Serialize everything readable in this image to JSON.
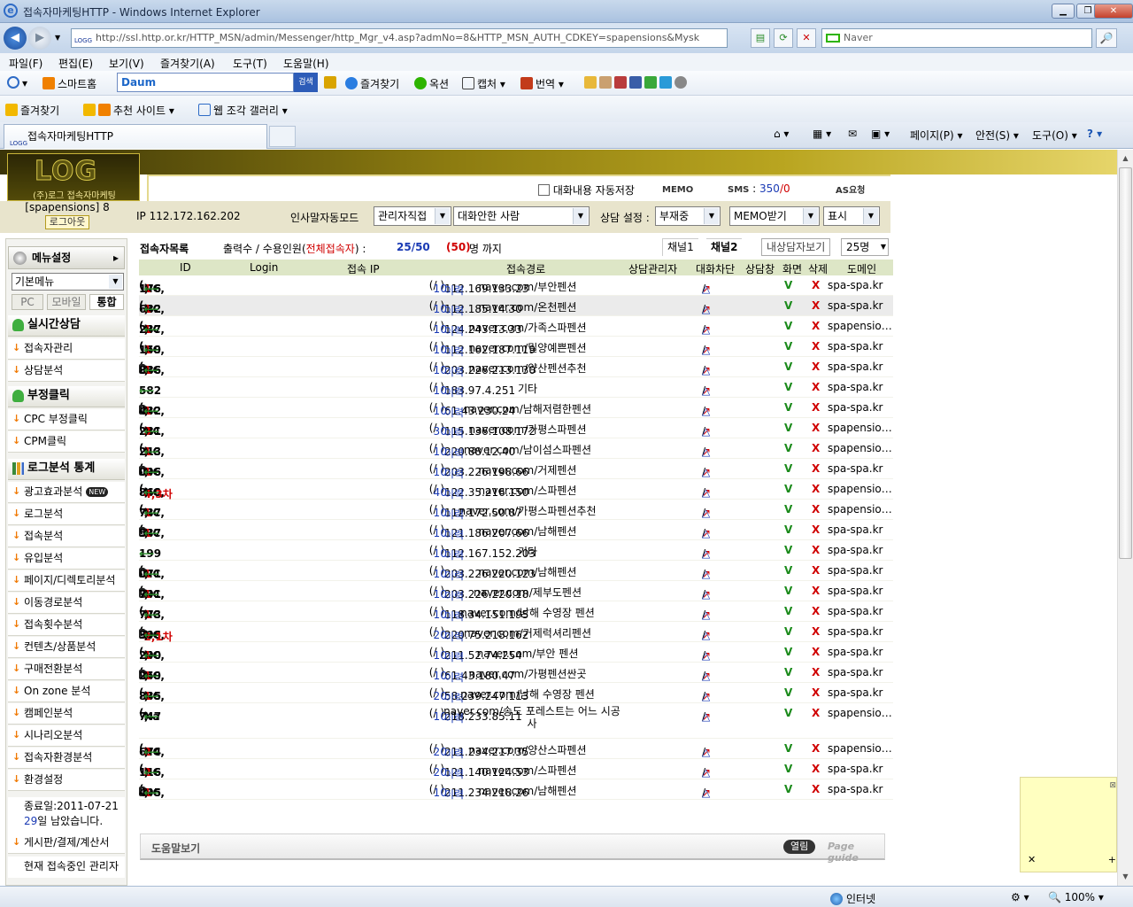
{
  "window": {
    "title": "접속자마케팅HTTP - Windows Internet Explorer",
    "min": "▁",
    "max": "❐",
    "close": "✕"
  },
  "address": {
    "url": "http://ssl.http.or.kr/HTTP_MSN/admin/Messenger/http_Mgr_v4.asp?admNo=8&HTTP_MSN_AUTH_CDKEY=spapensions&Mysk",
    "site_icon": "LOGG"
  },
  "search": {
    "placeholder": "Naver",
    "go": "🔎"
  },
  "menu": [
    "파일(F)",
    "편집(E)",
    "보기(V)",
    "즐겨찾기(A)",
    "도구(T)",
    "도움말(H)"
  ],
  "toolbar1": {
    "smarthome": "스마트홈",
    "daum_logo": "Daum",
    "daum_btn": "검색",
    "favorites": "즐겨찾기",
    "options": "옥션",
    "capture": "캡처",
    "translate": "번역"
  },
  "toolbar2": {
    "favorites": "즐겨찾기",
    "suggested": "추천 사이트",
    "webslice": "웹 조각 갤러리"
  },
  "tabs": {
    "active": "접속자마케팅HTTP",
    "page": "페이지(P)",
    "safety": "안전(S)",
    "tools": "도구(O)",
    "help": "?"
  },
  "header": {
    "logo": "LOG",
    "logo_sub": "(주)로그 접속자마케팅",
    "autosave": "대화내용 자동저장",
    "memo": "MEMO",
    "sms_label": "SMS",
    "sms_value": "350",
    "sms_zero": "0",
    "asreq": "AS요청"
  },
  "userbar": {
    "user": "[spapensions] 8",
    "logout": "로그아웃",
    "ip": "IP 112.172.162.202",
    "greet_label": "인사말자동모드",
    "greet_val": "관리자직접",
    "filter_val": "대화안한 사람",
    "consult_label": "상담 설정",
    "consult_val": "부재중",
    "memo_val": "MEMO받기",
    "show_val": "표시"
  },
  "sidebar": {
    "menu_title": "메뉴설정",
    "menu_select": "기본메뉴",
    "tabs": [
      "PC",
      "모바일",
      "통합"
    ],
    "sec1": "실시간상담",
    "sec1_items": [
      "접속자관리",
      "상담분석"
    ],
    "sec2": "부정클릭",
    "sec2_items": [
      "CPC 부정클릭",
      "CPM클릭"
    ],
    "sec3": "로그분석 통계",
    "sec3_items": [
      "광고효과분석",
      "로그분석",
      "접속분석",
      "유입분석",
      "페이지/디렉토리분석",
      "이동경로분석",
      "접속횟수분석",
      "컨텐츠/상품분석",
      "구매전환분석",
      "On zone 분석",
      "캠페인분석",
      "시나리오분석",
      "접속자환경분석",
      "환경설정"
    ],
    "new_badge": "NEW",
    "expiry": "종료일:2011-07-21",
    "remain_num": "29",
    "remain_txt": "일 남았습니다.",
    "board": "게시판/결제/계산서",
    "admin": "현재 접속중인 관리자"
  },
  "list": {
    "title": "접속자목록",
    "output_label": "출력수 / 수용인원(",
    "all_label": "전체접속자",
    "output_close": ") :",
    "ratio": "25/50",
    "cap": "(50)",
    "cap_tail": "명 까지",
    "ch1": "채널1",
    "ch2": "채널2",
    "view_btn": "내상담자보기",
    "per_page": "25명",
    "columns": [
      "ID",
      "Login",
      "접속 IP",
      "접속경로",
      "상담관리자",
      "대화차단",
      "상담창",
      "화면",
      "삭제",
      "도메인"
    ],
    "hist": "이력",
    "blk_a": "↗",
    "blk_b": "/",
    "blk_c": "△",
    "v": "V",
    "x": "X",
    "rows": [
      {
        "pre": "",
        "id": "176",
        "nc": "NC,",
        "n": "1",
        "post": ")",
        "ph": false,
        "cnt": "1",
        "z": "0",
        "ip": "112.169.133.23",
        "ref": "naver.com/부안펜션",
        "dom": "spa-spa.kr"
      },
      {
        "pre": "",
        "id": "682",
        "nc": "NC,",
        "n": "1",
        "post": ")",
        "ph": false,
        "cnt": "1",
        "z": "0",
        "ip": "112.185.14.30",
        "ref": "naver.com/온천펜션",
        "dom": "spa-spa.kr"
      },
      {
        "pre": "",
        "id": "237",
        "nc": "NC,",
        "n": "1",
        "post": ")",
        "ph": false,
        "cnt": "1",
        "z": "0",
        "ip": "124.243.13.33",
        "ref": "naver.com/가족스파펜션",
        "dom": "spapension..."
      },
      {
        "pre": "",
        "id": "159",
        "nc": "NC,",
        "n": "1",
        "post": ")",
        "ph": false,
        "cnt": "1",
        "z": "0",
        "ip": "112.162.187.119",
        "ref": "naver.com/밀양예쁜펜션",
        "dom": "spa-spa.kr"
      },
      {
        "pre": "",
        "id": "886",
        "nc": "NC,",
        "n": "1",
        "post": ")",
        "ph": true,
        "cnt": "1",
        "z": "0",
        "ip": "203.226.213.130",
        "ref": "naver.com/양산펜션추천",
        "dom": "spa-spa.kr"
      },
      {
        "pre": "",
        "id": "582",
        "nc": "",
        "n": "",
        "post": "",
        "ph": false,
        "cnt": "1",
        "z": "0",
        "ip": "183.97.4.251",
        "ref": "기타",
        "dom": "spa-spa.kr"
      },
      {
        "pre": "",
        "id": "432",
        "nc": "NC,",
        "n": "1",
        "post": ")",
        "ph": true,
        "cnt": "1",
        "z": "0",
        "ip": "61.43.230.24",
        "ref": "naver.com/남해저렴한펜션",
        "dom": "spa-spa.kr"
      },
      {
        "pre": "",
        "id": "281",
        "nc": "NC,",
        "n": "3",
        "post": ")",
        "ph": false,
        "cnt": "3",
        "z": "0",
        "ip": "115.136.108.172",
        "ref": "naver.com/가평스파펜션",
        "dom": "spapension..."
      },
      {
        "pre": "",
        "id": "213",
        "nc": "NC,",
        "n": "1",
        "post": ")",
        "ph": false,
        "cnt": "1",
        "z": "0",
        "ip": "220.88.12.40",
        "ref": "naver.com/남이섬스파펜션",
        "dom": "spapension..."
      },
      {
        "pre": "",
        "id": "096",
        "nc": "NC,",
        "n": "1",
        "post": ")",
        "ph": true,
        "cnt": "1",
        "z": "0",
        "ip": "203.226.198.66",
        "ref": "naver.com/거제펜션",
        "dom": "spa-spa.kr"
      },
      {
        "pre": "",
        "id": "860",
        "nc": "NC,",
        "n": "4,3차",
        "post": ")",
        "ph": false,
        "cnt": "4",
        "z": "0",
        "ip": "122.35.216.150",
        "ref": "naver.com/스파펜션",
        "dom": "spapension..."
      },
      {
        "pre": "",
        "id": "737",
        "nc": "NC,",
        "n": "1",
        "post": ")",
        "ph": false,
        "cnt": "1",
        "z": "0",
        "ip": "112.172.50.87",
        "ref": "naver.com/가평스파펜션추천",
        "dom": "spapension..."
      },
      {
        "pre": "",
        "id": "537",
        "nc": "NC,",
        "n": "1",
        "post": ")",
        "ph": true,
        "cnt": "1",
        "z": "0",
        "ip": "121.186.207.66",
        "ref": "naver.com/남해펜션",
        "dom": "spa-spa.kr"
      },
      {
        "pre": "",
        "id": "199",
        "nc": "",
        "n": "",
        "post": "",
        "ph": false,
        "cnt": "1",
        "z": "0",
        "ip": "112.167.152.203",
        "ref": "기타",
        "dom": "spa-spa.kr"
      },
      {
        "pre": "",
        "id": "071",
        "nc": "NC,",
        "n": "1",
        "post": ")",
        "ph": true,
        "cnt": "1",
        "z": "0",
        "ip": "203.226.220.123",
        "ref": "naver.com/남해펜션",
        "dom": "spa-spa.kr"
      },
      {
        "pre": "",
        "id": "791",
        "nc": "NC,",
        "n": "1",
        "post": ")",
        "ph": true,
        "cnt": "1",
        "z": "0",
        "ip": "203.226.220.18",
        "ref": "naver.com/제부도펜션",
        "dom": "spa-spa.kr"
      },
      {
        "pre": "",
        "id": "773",
        "nc": "NC,",
        "n": "1",
        "post": ")",
        "ph": false,
        "cnt": "1",
        "z": "0",
        "ip": "118.34.151.195",
        "ref": "naver.com/남해 수영장 펜션",
        "dom": "spa-spa.kr"
      },
      {
        "pre": "",
        "id": "396",
        "nc": "NC,",
        "n": "2,1차",
        "post": ")",
        "ph": true,
        "cnt": "2",
        "z": "0",
        "ip": "220.75.218.162",
        "ref": "naver.com/거제럭셔리펜션",
        "dom": "spa-spa.kr"
      },
      {
        "pre": "",
        "id": "290",
        "nc": "NC,",
        "n": "1",
        "post": ")",
        "ph": false,
        "cnt": "1",
        "z": "0",
        "ip": "211.52.74.254",
        "ref": "naver.com/부안 펜션",
        "dom": "spa-spa.kr"
      },
      {
        "pre": "",
        "id": "259",
        "nc": "NC,",
        "n": "1",
        "post": ")",
        "ph": true,
        "cnt": "1",
        "z": "0",
        "ip": "61.43.180.47",
        "ref": "naver.com/가평펜션싼곳",
        "dom": "spa-spa.kr"
      },
      {
        "pre": "",
        "id": "835",
        "nc": "NC,",
        "n": "1",
        "post": ")",
        "ph": false,
        "cnt": "2",
        "z": "0",
        "ip": "58.239.247.113",
        "ref": "naver.com/남해 수영장 펜션",
        "dom": "spa-spa.kr"
      },
      {
        "pre": "",
        "id": "747",
        "nc": "Na",
        "n": "",
        "post": ")",
        "ph": false,
        "cnt": "1",
        "z": "0",
        "ip": "218.233.85.11",
        "ref": "naver.com/송도 포레스트는 어느 시공사",
        "dom": "spapension..."
      },
      {
        "pre": "",
        "id": "674",
        "nc": "NC,",
        "n": "2",
        "post": ")",
        "ph": false,
        "cnt": "2",
        "z": "0",
        "ip": "211.234.217.35",
        "ref": "naver.com/양산스파펜션",
        "dom": "spapension..."
      },
      {
        "pre": "",
        "id": "116",
        "nc": "NC,",
        "n": "2",
        "post": ")",
        "ph": false,
        "cnt": "2",
        "z": "0",
        "ip": "121.140.124.53",
        "ref": "naver.com/스파펜션",
        "dom": "spa-spa.kr"
      },
      {
        "pre": "",
        "id": "495",
        "nc": "NC,",
        "n": "1",
        "post": ")",
        "ph": true,
        "cnt": "1",
        "z": "0",
        "ip": "211.234.218.26",
        "ref": "naver.com/남해펜션",
        "dom": "spa-spa.kr"
      }
    ]
  },
  "help": {
    "title": "도움말보기",
    "open": "열림",
    "guide": "Page guide"
  },
  "status": {
    "zone": "인터넷",
    "zoom": "100%"
  }
}
